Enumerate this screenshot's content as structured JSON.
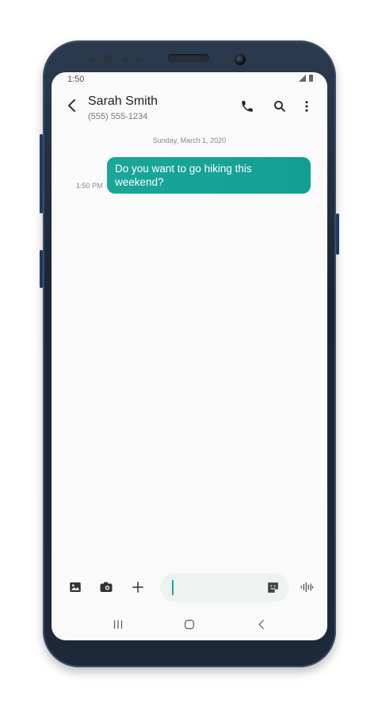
{
  "status_bar": {
    "time": "1:50"
  },
  "header": {
    "contact_name": "Sarah Smith",
    "contact_number": "(555) 555-1234"
  },
  "conversation": {
    "date": "Sunday, March 1, 2020",
    "messages": [
      {
        "text": "Do you want to go hiking this weekend?",
        "time": "1:50 PM",
        "direction": "outgoing"
      }
    ]
  },
  "compose": {
    "message_value": "",
    "placeholder": ""
  },
  "colors": {
    "accent": "#1aa699",
    "frame": "#1d2838"
  },
  "icons": [
    "back-arrow-icon",
    "phone-icon",
    "search-icon",
    "more-vert-icon",
    "gallery-icon",
    "camera-icon",
    "plus-icon",
    "sticker-icon",
    "voice-icon",
    "recents-icon",
    "home-icon",
    "back-icon"
  ]
}
